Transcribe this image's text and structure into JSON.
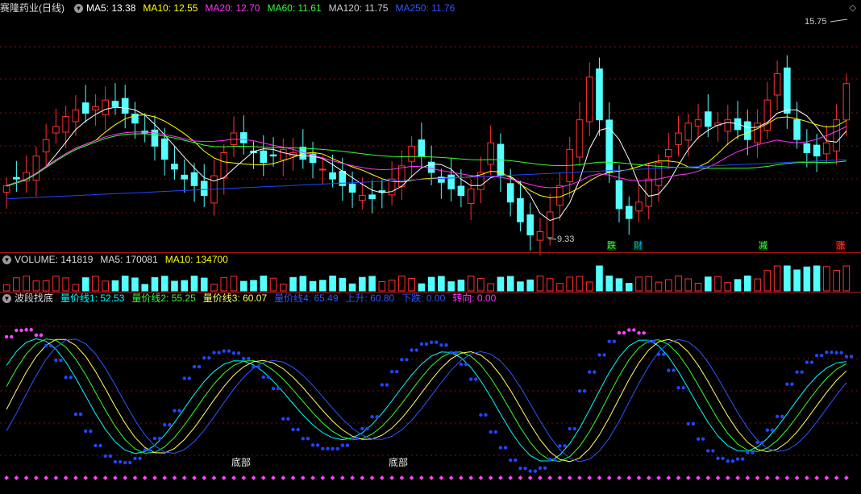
{
  "main": {
    "stock_name": "赛隆药业(日线)",
    "ma_labels": [
      {
        "text": "MA5: 13.38",
        "color": "#ffffff"
      },
      {
        "text": "MA10: 12.55",
        "color": "#ffff00"
      },
      {
        "text": "MA20: 12.70",
        "color": "#ff33ff"
      },
      {
        "text": "MA60: 11.61",
        "color": "#33ff33"
      },
      {
        "text": "MA120: 11.75",
        "color": "#cccccc"
      },
      {
        "text": "MA250: 11.76",
        "color": "#3355ff"
      }
    ],
    "high_label": "15.75",
    "low_label": "9.33",
    "markers": [
      {
        "text": "跌",
        "color": "#33ff33"
      },
      {
        "text": "财",
        "color": "#00aaff"
      },
      {
        "text": "减",
        "color": "#33ff33"
      },
      {
        "text": "涨",
        "color": "#ff4444"
      }
    ]
  },
  "volume": {
    "labels": [
      {
        "text": "VOLUME: 141819",
        "color": "#dddddd"
      },
      {
        "text": "MA5: 170081",
        "color": "#dddddd"
      },
      {
        "text": "MA10: 134700",
        "color": "#ffff00"
      }
    ]
  },
  "indicator": {
    "name": "波段找底",
    "labels": [
      {
        "text": "量价线1: 52.53",
        "color": "#00ffff"
      },
      {
        "text": "量价线2: 55.25",
        "color": "#33ff33"
      },
      {
        "text": "量价线3: 60.07",
        "color": "#ffff66"
      },
      {
        "text": "量价线4: 65.49",
        "color": "#3355ff"
      },
      {
        "text": "上升: 60.80",
        "color": "#3355ff"
      },
      {
        "text": "下跌: 0.00",
        "color": "#3355ff"
      },
      {
        "text": "转向: 0.00",
        "color": "#ff33ff"
      }
    ],
    "bottom_label_1": "底部",
    "bottom_label_2": "底部"
  },
  "chart_data": {
    "type": "candlestick",
    "price_range": [
      9.33,
      15.75
    ],
    "close_series_approx": [
      11.0,
      11.2,
      11.4,
      11.9,
      12.4,
      12.8,
      13.1,
      13.3,
      13.2,
      13.4,
      13.6,
      13.4,
      13.2,
      12.9,
      12.6,
      12.2,
      11.8,
      11.5,
      11.2,
      11.0,
      10.7,
      11.3,
      12.0,
      12.6,
      12.3,
      12.0,
      11.7,
      11.9,
      12.1,
      12.0,
      11.8,
      11.7,
      11.5,
      11.2,
      11.0,
      10.8,
      10.7,
      10.6,
      10.8,
      11.2,
      11.6,
      12.2,
      11.9,
      11.4,
      11.1,
      10.9,
      10.7,
      10.9,
      11.4,
      12.3,
      11.3,
      10.5,
      9.9,
      9.5,
      9.6,
      10.2,
      11.0,
      12.1,
      13.0,
      14.3,
      13.0,
      11.4,
      10.3,
      10.0,
      10.5,
      11.2,
      11.7,
      12.1,
      12.6,
      12.9,
      13.0,
      12.8,
      12.9,
      13.0,
      12.7,
      12.4,
      12.9,
      13.6,
      14.4,
      13.2,
      12.4,
      12.0,
      11.9,
      12.3,
      13.0,
      14.1
    ]
  }
}
